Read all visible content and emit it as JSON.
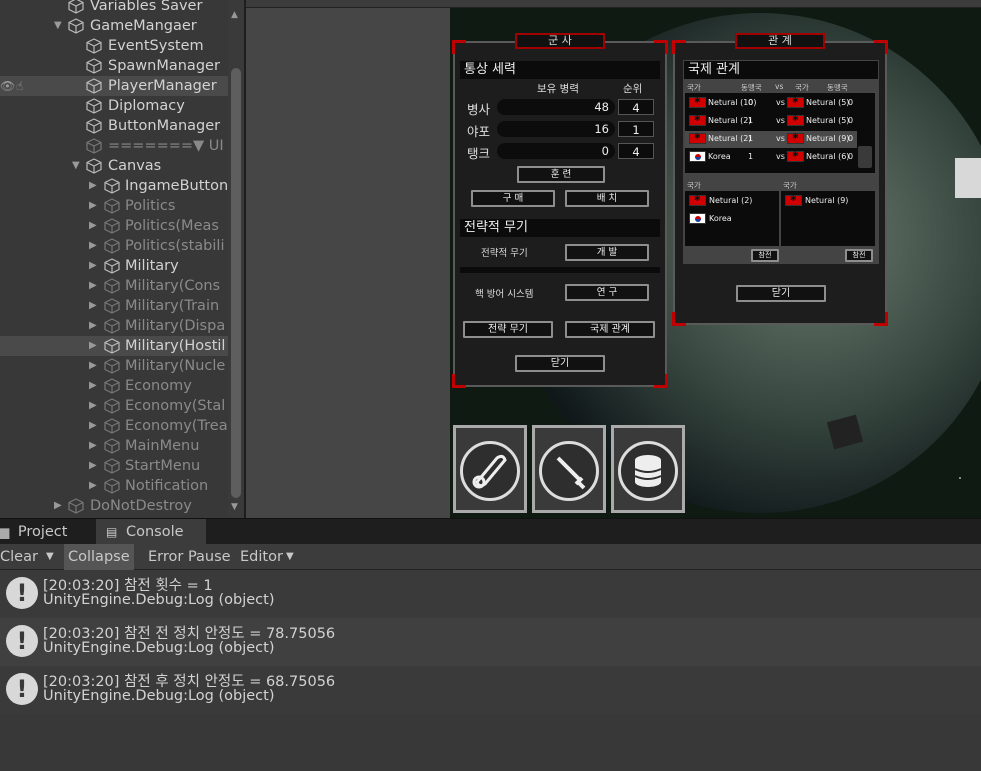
{
  "hierarchy": {
    "items": [
      {
        "label": "Variables Saver",
        "dim": false
      },
      {
        "label": "GameMangaer",
        "dim": false
      },
      {
        "label": "EventSystem",
        "dim": false
      },
      {
        "label": "SpawnManager",
        "dim": false
      },
      {
        "label": "PlayerManager",
        "dim": false
      },
      {
        "label": "Diplomacy",
        "dim": false
      },
      {
        "label": "ButtonManager",
        "dim": false
      },
      {
        "label": "=======▼ UI",
        "dim": true
      },
      {
        "label": "Canvas",
        "dim": false
      },
      {
        "label": "IngameButton",
        "dim": false
      },
      {
        "label": "Politics",
        "dim": true
      },
      {
        "label": "Politics(Meas",
        "dim": true
      },
      {
        "label": "Politics(stabili",
        "dim": true
      },
      {
        "label": "Military",
        "dim": false
      },
      {
        "label": "Military(Cons",
        "dim": true
      },
      {
        "label": "Military(Train",
        "dim": true
      },
      {
        "label": "Military(Dispa",
        "dim": true
      },
      {
        "label": "Military(Hostil",
        "dim": false
      },
      {
        "label": "Military(Nucle",
        "dim": true
      },
      {
        "label": "Economy",
        "dim": true
      },
      {
        "label": "Economy(Stal",
        "dim": true
      },
      {
        "label": "Economy(Trea",
        "dim": true
      },
      {
        "label": "MainMenu",
        "dim": true
      },
      {
        "label": "StartMenu",
        "dim": true
      },
      {
        "label": "Notification",
        "dim": true
      },
      {
        "label": "DoNotDestroy",
        "dim": true
      }
    ]
  },
  "military_panel": {
    "tab": "군 사",
    "section_trade": "통상 세력",
    "col_forces": "보유 병력",
    "col_rank": "순위",
    "units": [
      {
        "name": "병사",
        "value": "48",
        "rank": "4"
      },
      {
        "name": "야포",
        "value": "16",
        "rank": "1"
      },
      {
        "name": "탱크",
        "value": "0",
        "rank": "4"
      }
    ],
    "train_btn": "훈 련",
    "buy_btn": "구 매",
    "deploy_btn": "배 치",
    "section_strategic": "전략적 무기",
    "strategic_label": "전략적 무기",
    "develop_btn": "개 발",
    "nuke_defense_label": "핵 방어 시스템",
    "research_btn": "연 구",
    "strategic_weapon_btn": "전략 무기",
    "intl_relations_btn": "국제 관계",
    "close_btn": "닫기"
  },
  "relations_panel": {
    "tab": "관 계",
    "section_title": "국제 관계",
    "headers": [
      "국가",
      "동맹국",
      "vs",
      "국가",
      "동맹국"
    ],
    "rows": [
      {
        "left": "Netural (10)",
        "lallies": "0",
        "vs": "vs",
        "right": "Netural (5)",
        "rallies": "0",
        "left_flag": "red",
        "right_flag": "red"
      },
      {
        "left": "Netural (2)",
        "lallies": "1",
        "vs": "vs",
        "right": "Netural (5)",
        "rallies": "0",
        "left_flag": "red",
        "right_flag": "red"
      },
      {
        "left": "Netural (2)",
        "lallies": "1",
        "vs": "vs",
        "right": "Netural (9)",
        "rallies": "0",
        "left_flag": "red",
        "right_flag": "red"
      },
      {
        "left": "Korea",
        "lallies": "1",
        "vs": "vs",
        "right": "Netural (6)",
        "rallies": "0",
        "left_flag": "kr",
        "right_flag": "red"
      }
    ],
    "left_list_header": "국가",
    "right_list_header": "국가",
    "left_list": [
      "Netural (2)",
      "Korea"
    ],
    "right_list": [
      "Netural (9)"
    ],
    "join_left": "참전",
    "join_right": "참전",
    "close_btn": "닫기"
  },
  "tabs": {
    "project": "Project",
    "console": "Console"
  },
  "toolbar": {
    "clear": "Clear",
    "collapse": "Collapse",
    "error_pause": "Error Pause",
    "editor": "Editor"
  },
  "console": {
    "entries": [
      {
        "line1": "[20:03:20] 참전 횟수 = 1",
        "line2": "UnityEngine.Debug:Log (object)"
      },
      {
        "line1": "[20:03:20] 참전 전 정치 안정도 = 78.75056",
        "line2": "UnityEngine.Debug:Log (object)"
      },
      {
        "line1": "[20:03:20] 참전 후 정치 안정도 = 68.75056",
        "line2": "UnityEngine.Debug:Log (object)"
      }
    ]
  }
}
